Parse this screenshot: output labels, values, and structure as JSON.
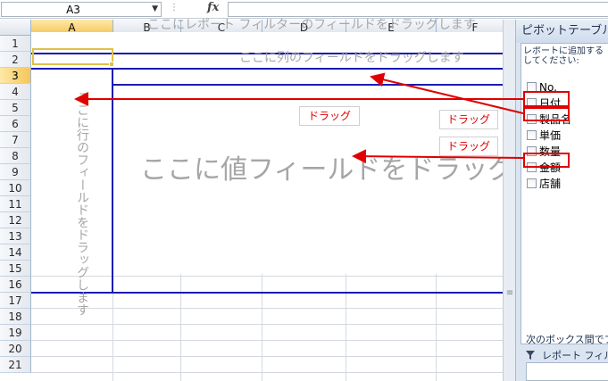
{
  "formula_bar": {
    "name_box": "A3",
    "fx_label": "fx",
    "formula": ""
  },
  "columns": [
    "A",
    "B",
    "C",
    "D",
    "E",
    "F"
  ],
  "rows": [
    "1",
    "2",
    "3",
    "4",
    "5",
    "6",
    "7",
    "8",
    "9",
    "10",
    "11",
    "12",
    "13",
    "14",
    "15",
    "16",
    "17",
    "18",
    "19",
    "20",
    "21"
  ],
  "selected_cell": {
    "column": "A",
    "row": "3"
  },
  "pivot_area": {
    "filter_hint": "ここにレポート フィルターのフィールドをドラッグします",
    "column_hint": "ここに列のフィールドをドラッグします",
    "row_hint": "ここに行のフィールドをドラッグします",
    "value_hint": "ここに値フィールドをドラッグし"
  },
  "annotations": {
    "drag_1": "ドラッグ",
    "drag_2": "ドラッグ",
    "drag_3": "ドラッグ",
    "annotation_color": "#e00000"
  },
  "panel": {
    "title": "ピボットテーブル",
    "instruction_line1": "レポートに追加する",
    "instruction_line2": "してください:",
    "fields": [
      "No.",
      "日付",
      "製品名",
      "単価",
      "数量",
      "金額",
      "店舗"
    ],
    "lower_label": "次のボックス間でフィ",
    "filter_section_label": "レポート フィル"
  },
  "colors": {
    "pivot_border": "#1a1ab4",
    "hint_text": "#a6a6a6",
    "selection_header": "#f6c55a",
    "panel_bg": "#dbe5f1"
  }
}
